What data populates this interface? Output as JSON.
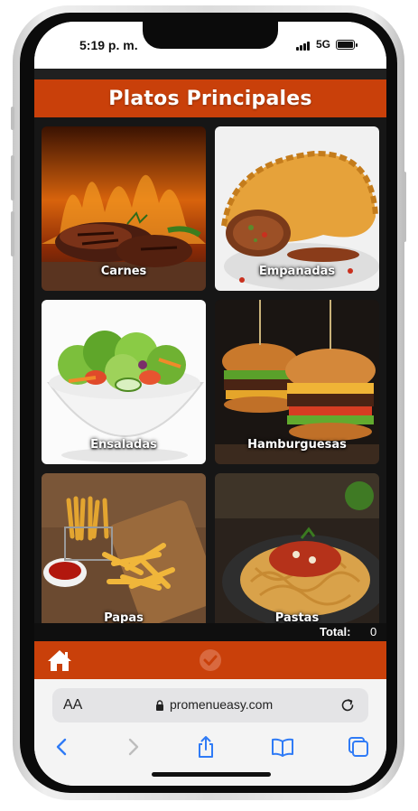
{
  "status_bar": {
    "time": "5:19 p. m.",
    "network": "5G"
  },
  "header": {
    "title": "Platos Principales"
  },
  "categories": [
    {
      "label": "Carnes"
    },
    {
      "label": "Empanadas"
    },
    {
      "label": "Ensaladas"
    },
    {
      "label": "Hamburguesas"
    },
    {
      "label": "Papas"
    },
    {
      "label": "Pastas"
    }
  ],
  "total": {
    "label": "Total:",
    "value": "0"
  },
  "browser": {
    "text_size_label": "AA",
    "url": "promenueasy.com"
  },
  "icons": {
    "home": "home-icon",
    "check": "check-icon",
    "lock": "lock-icon",
    "reload": "reload-icon",
    "back": "chevron-left-icon",
    "forward": "chevron-right-icon",
    "share": "share-icon",
    "bookmarks": "book-icon",
    "tabs": "tabs-icon"
  },
  "colors": {
    "accent": "#c9400a",
    "safari_blue": "#2f7bf6"
  }
}
